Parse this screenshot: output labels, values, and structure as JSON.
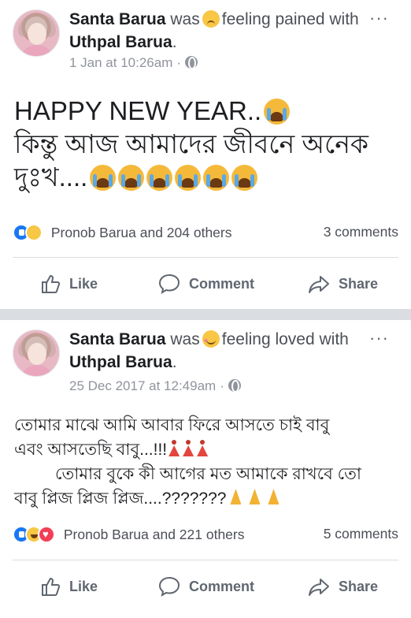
{
  "posts": [
    {
      "author": "Santa Barua",
      "verb": "was",
      "feeling_icon": "sad-face-emoji",
      "feeling": "feeling",
      "feeling_rest": "pained with",
      "tagged": "Uthpal Barua",
      "period": ".",
      "timestamp": "1 Jan at 10:26am",
      "dot": "·",
      "more": "···",
      "text_line1": "HAPPY NEW YEAR..",
      "text_line2": "কিন্তু আজ আমাদের জীবনে অনেক",
      "text_line3": "দুঃখ....",
      "reactions": [
        "like",
        "sad"
      ],
      "reaction_names": "Pronob Barua and 204 others",
      "comments": "3 comments",
      "actions": {
        "like": "Like",
        "comment": "Comment",
        "share": "Share"
      }
    },
    {
      "author": "Santa Barua",
      "verb": "was",
      "feeling_icon": "smiling-face-with-hearts-emoji",
      "feeling": "feeling loved",
      "feeling_rest": "with",
      "tagged": "Uthpal Barua",
      "period": ".",
      "timestamp": "25 Dec 2017 at 12:49am",
      "dot": "·",
      "more": "···",
      "text_line1": "তোমার মাঝে  আমি আবার ফিরে আসতে চাই বাবু",
      "text_line2": "এবং আসতেছি বাবু...!!!",
      "text_line3": "তোমার বুকে কী আগের মত আমাকে রাখবে তো",
      "text_line4": "বাবু প্লিজ প্লিজ প্লিজ....???????",
      "reactions": [
        "like",
        "haha",
        "love"
      ],
      "reaction_names": "Pronob Barua and 221 others",
      "comments": "5 comments",
      "actions": {
        "like": "Like",
        "comment": "Comment",
        "share": "Share"
      }
    }
  ],
  "colors": {
    "brand_blue": "#1877f2",
    "text": "#1c1e21",
    "muted": "#90949c",
    "separator": "#dadde1"
  }
}
